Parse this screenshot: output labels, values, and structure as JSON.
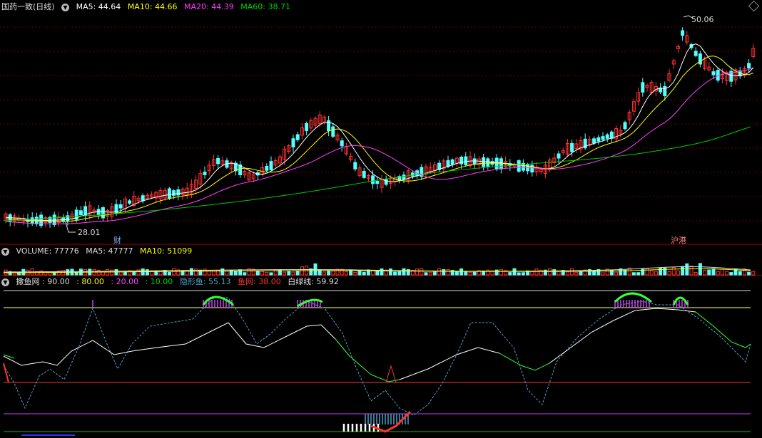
{
  "main": {
    "title": "国药一致(日线)",
    "ma5_label": "MA5: 44.64",
    "ma10_label": "MA10: 44.66",
    "ma20_label": "MA20: 44.39",
    "ma60_label": "MA60: 38.71",
    "high_label": "50.06",
    "low_label": "28.01",
    "marker_cai": "财",
    "marker_hgt": "沪港",
    "colors": {
      "up": "#ff3232",
      "down": "#54ffff",
      "ma5": "#ffffff",
      "ma10": "#ffff00",
      "ma20": "#ff40ff",
      "ma60": "#00c800"
    }
  },
  "volume": {
    "label": "VOLUME: 77776",
    "ma5_label": "MA5: 47777",
    "ma10_label": "MA10: 51099"
  },
  "indicator": {
    "name": "撒鱼网",
    "l90": ": 90.00",
    "l80": ": 80.00",
    "l20": ": 20.00",
    "l10": ": 10.00",
    "hidden_fish": "隐形鱼: 55.13",
    "fish_net": "鱼网: 38.00",
    "white_green": "白绿线: 59.92"
  }
}
